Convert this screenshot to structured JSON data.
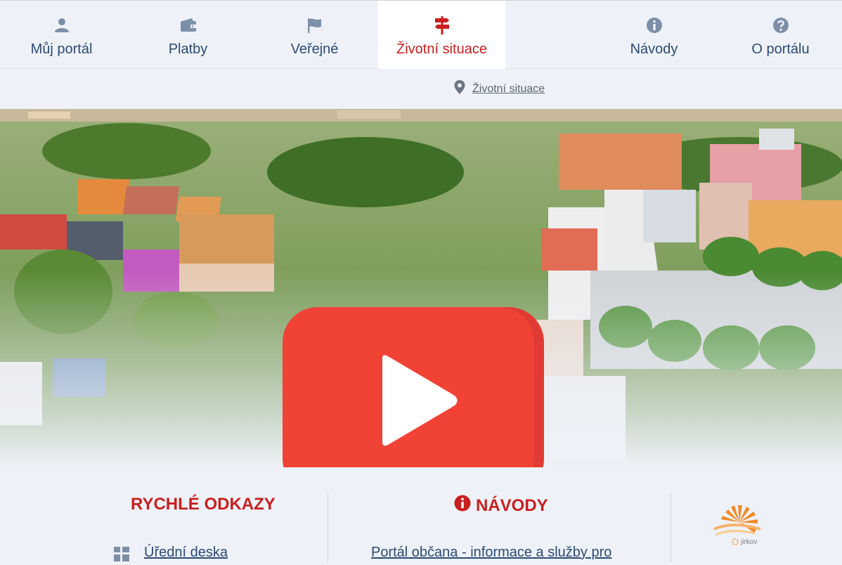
{
  "nav": {
    "tabs": [
      {
        "label": "Můj portál",
        "icon": "user-icon"
      },
      {
        "label": "Platby",
        "icon": "wallet-icon"
      },
      {
        "label": "Veřejné",
        "icon": "flag-icon"
      },
      {
        "label": "Životní situace",
        "icon": "signpost-icon",
        "active": true
      },
      {
        "label": "Návody",
        "icon": "info-icon"
      },
      {
        "label": "O portálu",
        "icon": "question-icon"
      }
    ]
  },
  "breadcrumb": {
    "label": "Životní situace",
    "icon": "map-pin-icon"
  },
  "hero": {
    "video_icon": "play-icon"
  },
  "quick_links": {
    "title": "RYCHLÉ ODKAZY",
    "items": [
      {
        "label": "Úřední deska",
        "icon": "grid-icon"
      }
    ]
  },
  "guides": {
    "title": "NÁVODY",
    "icon": "info-icon",
    "items": [
      {
        "label": "Portál občana - informace a služby pro"
      }
    ]
  },
  "logo": {
    "text": "jirkov"
  },
  "colors": {
    "accent": "#c91f1f",
    "nav_text": "#2b4a73",
    "play_red": "#f14236"
  }
}
